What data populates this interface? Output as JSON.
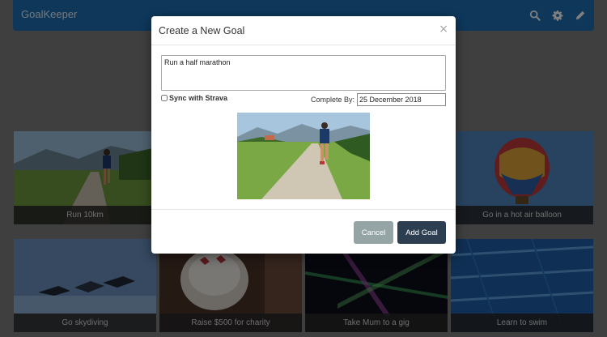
{
  "app": {
    "brand": "GoalKeeper"
  },
  "navbar": {
    "icons": [
      "search-icon",
      "gear-icon",
      "pencil-icon"
    ]
  },
  "goals": [
    {
      "caption": "Run 10km"
    },
    {
      "caption": "Go in a hot air balloon"
    },
    {
      "caption": "Go skydiving"
    },
    {
      "caption": "Raise $500 for charity"
    },
    {
      "caption": "Take Mum to a gig"
    },
    {
      "caption": "Learn to swim"
    }
  ],
  "modal": {
    "title": "Create a New Goal",
    "close_symbol": "×",
    "goal_text": "Run a half marathon",
    "sync_label": "Sync with Strava",
    "sync_checked": false,
    "complete_by_label": "Complete By:",
    "complete_by_value": "25 December 2018",
    "cancel_label": "Cancel",
    "add_label": "Add Goal"
  },
  "colors": {
    "navbar": "#1d6fb4",
    "cancel_button": "#95a5a6",
    "add_button": "#2c3e50"
  }
}
